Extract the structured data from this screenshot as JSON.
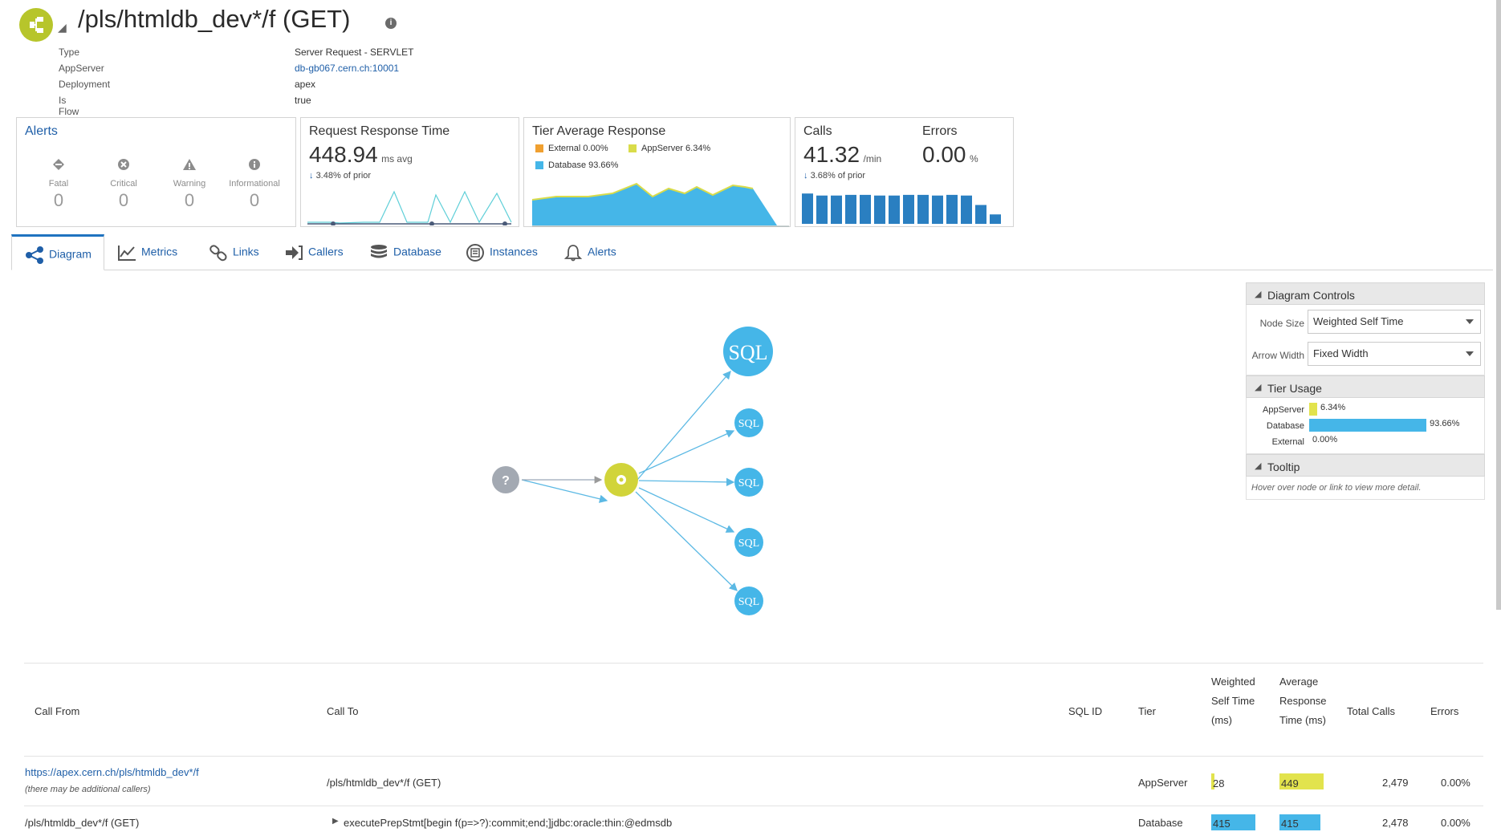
{
  "header": {
    "title": "/pls/htmldb_dev*/f (GET)",
    "info_glyph": "i",
    "properties": [
      {
        "label": "Type",
        "value": "Server Request - SERVLET"
      },
      {
        "label": "AppServer",
        "value": "db-gb067.cern.ch:10001"
      },
      {
        "label": "Deployment",
        "value": "apex"
      },
      {
        "label": "Is Flow Start",
        "value": "true"
      }
    ]
  },
  "alerts_card": {
    "title": "Alerts",
    "items": [
      {
        "name": "Fatal",
        "count": "0",
        "icon": "fatal-diamond-icon"
      },
      {
        "name": "Critical",
        "count": "0",
        "icon": "critical-x-icon"
      },
      {
        "name": "Warning",
        "count": "0",
        "icon": "warning-triangle-icon"
      },
      {
        "name": "Informational",
        "count": "0",
        "icon": "info-circle-icon"
      }
    ]
  },
  "response_card": {
    "title": "Request Response Time",
    "value": "448.94",
    "unit": "ms avg",
    "delta": "3.48% of prior"
  },
  "tier_card": {
    "title": "Tier Average Response",
    "legend": [
      {
        "label": "External 0.00%",
        "color": "#f0a030"
      },
      {
        "label": "AppServer 6.34%",
        "color": "#d9dc4a"
      },
      {
        "label": "Database 93.66%",
        "color": "#45b6e8"
      }
    ]
  },
  "calls_card": {
    "calls_title": "Calls",
    "calls_value": "41.32",
    "calls_unit": "/min",
    "calls_delta": "3.68% of prior",
    "errors_title": "Errors",
    "errors_value": "0.00",
    "errors_unit": "%",
    "bars": [
      0.9,
      0.84,
      0.84,
      0.86,
      0.86,
      0.84,
      0.84,
      0.86,
      0.86,
      0.84,
      0.86,
      0.84,
      0.56,
      0.28
    ]
  },
  "tabs": [
    {
      "label": "Diagram",
      "icon": "diagram-share-icon",
      "active": true
    },
    {
      "label": "Metrics",
      "icon": "metrics-chart-icon",
      "active": false
    },
    {
      "label": "Links",
      "icon": "links-chain-icon",
      "active": false
    },
    {
      "label": "Callers",
      "icon": "callers-arrow-icon",
      "active": false
    },
    {
      "label": "Database",
      "icon": "database-icon",
      "active": false
    },
    {
      "label": "Instances",
      "icon": "instances-icon",
      "active": false
    },
    {
      "label": "Alerts",
      "icon": "bell-icon",
      "active": false
    }
  ],
  "diagram": {
    "unknown_node": "?",
    "sql_label": "SQL"
  },
  "panel": {
    "controls_title": "Diagram Controls",
    "node_size_label": "Node Size",
    "node_size_value": "Weighted Self Time",
    "arrow_width_label": "Arrow Width",
    "arrow_width_value": "Fixed Width",
    "tier_usage_title": "Tier Usage",
    "tiers": [
      {
        "name": "AppServer",
        "pct": "6.34%",
        "fraction": 0.0634,
        "color": "#e2e34d"
      },
      {
        "name": "Database",
        "pct": "93.66%",
        "fraction": 0.9366,
        "color": "#45b6e8"
      },
      {
        "name": "External",
        "pct": "0.00%",
        "fraction": 0,
        "color": "#f0a030"
      }
    ],
    "tooltip_title": "Tooltip",
    "tooltip_hint": "Hover over node or link to view more detail."
  },
  "table": {
    "headers": {
      "call_from": "Call From",
      "call_to": "Call To",
      "sql_id": "SQL ID",
      "tier": "Tier",
      "weighted_self_time": [
        "Weighted",
        "Self Time",
        "(ms)"
      ],
      "avg_response_time": [
        "Average",
        "Response",
        "Time (ms)"
      ],
      "total_calls": "Total Calls",
      "errors": "Errors"
    },
    "rows": [
      {
        "call_from": "https://apex.cern.ch/pls/htmldb_dev*/f",
        "call_from_note": "(there may be additional callers)",
        "call_to": "/pls/htmldb_dev*/f (GET)",
        "sql_id": "",
        "tier": "AppServer",
        "weighted_self_time": "28",
        "avg_response_time": "449",
        "total_calls": "2,479",
        "errors": "0.00%"
      },
      {
        "call_from": "/pls/htmldb_dev*/f (GET)",
        "call_to": "executePrepStmt[begin f(p=>?):commit;end;]jdbc:oracle:thin:@edmsdb",
        "expand_glyph": "▶",
        "sql_id": "",
        "tier": "Database",
        "weighted_self_time": "415",
        "avg_response_time": "415",
        "total_calls": "2,478",
        "errors": "0.00%"
      }
    ]
  }
}
